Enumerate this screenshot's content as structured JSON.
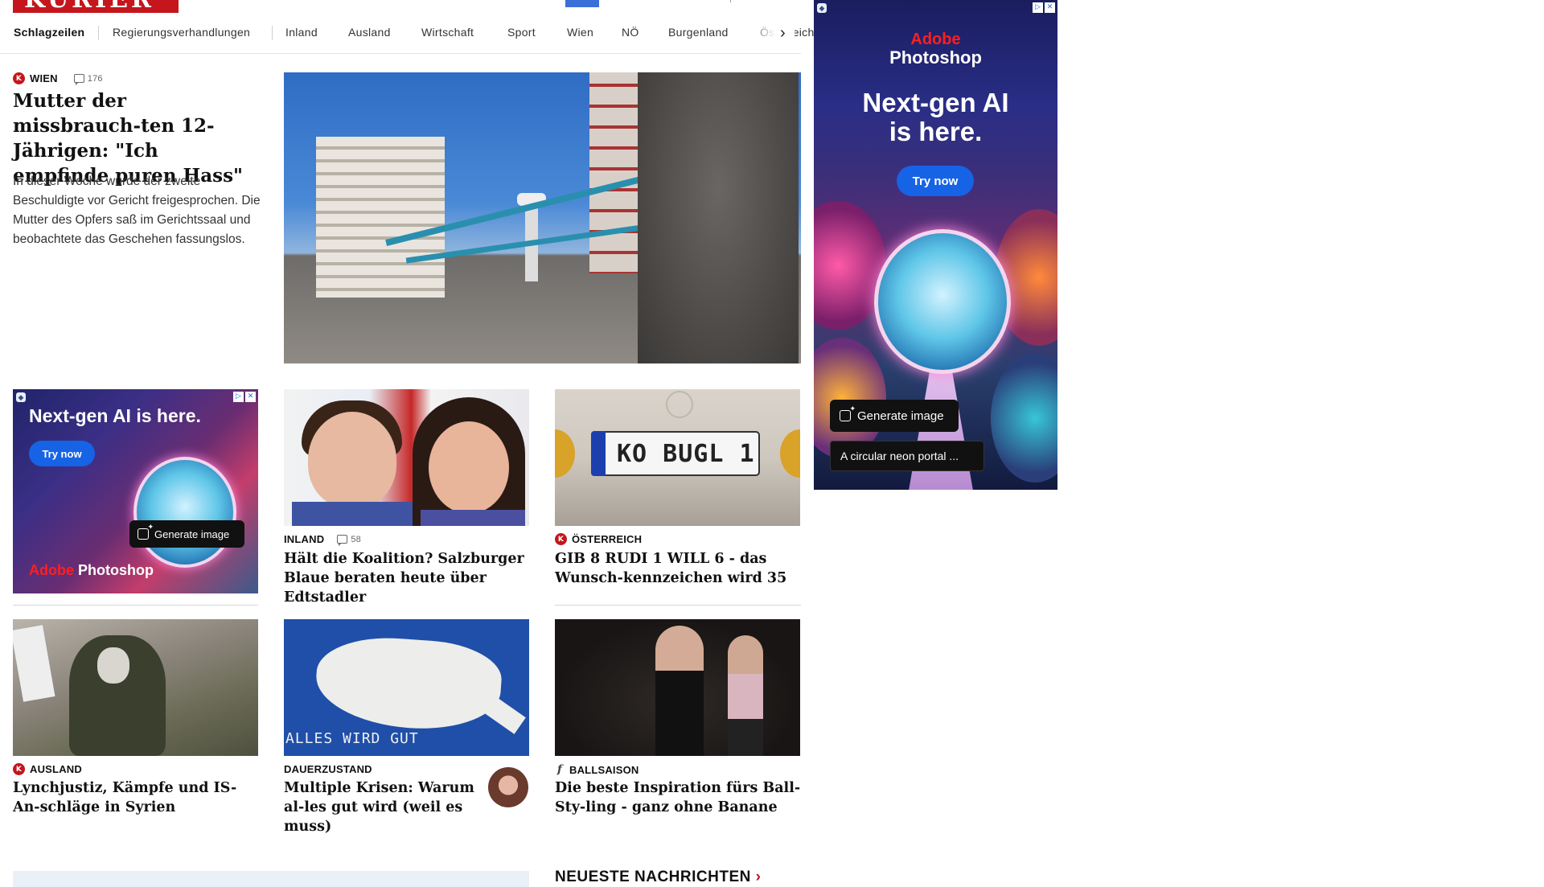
{
  "header": {
    "logo": "KURIER"
  },
  "nav": {
    "items": [
      {
        "label": "Schlagzeilen"
      },
      {
        "label": "Regierungsverhandlungen"
      },
      {
        "label": "Inland"
      },
      {
        "label": "Ausland"
      },
      {
        "label": "Wirtschaft"
      },
      {
        "label": "Sport"
      },
      {
        "label": "Wien"
      },
      {
        "label": "NÖ"
      },
      {
        "label": "Burgenland"
      },
      {
        "label": "Österreich"
      }
    ],
    "next_icon": "chevron-right-icon"
  },
  "lead": {
    "kicker": "WIEN",
    "comments": "176",
    "headline": "Mutter der missbrauch-ten 12-Jährigen: \"Ich empfinde puren Hass\"",
    "teaser": "In dieser Woche wurde der zweite Beschuldigte vor Gericht freigesprochen. Die Mutter des Opfers saß im Gerichtssaal und beobachtete das Geschehen fassungslos."
  },
  "cards": [
    {
      "kicker": "INLAND",
      "comments": "58",
      "headline": "Hält die Koalition? Salzburger Blaue beraten heute über Edtstadler"
    },
    {
      "kicker": "ÖSTERREICH",
      "headline": "GIB 8 RUDI 1 WILL 6 - das Wunsch-kennzeichen wird 35",
      "plate": "KO BUGL 1"
    },
    {
      "kicker": "AUSLAND",
      "headline": "Lynchjustiz, Kämpfe und IS-An-schläge in Syrien"
    },
    {
      "kicker": "DAUERZUSTAND",
      "headline": "Multiple Krisen: Warum al-les gut wird (weil es muss)",
      "image_text": "ALLES WIRD GUT"
    },
    {
      "kicker": "BALLSAISON",
      "headline": "Die beste Inspiration fürs Ball-Sty-ling - ganz ohne Banane"
    }
  ],
  "ad_side": {
    "brand_a": "Adobe",
    "brand_b": "Photoshop",
    "headline": "Next-gen AI is here.",
    "cta": "Try now",
    "generate": "Generate image",
    "prompt": "A circular neon portal ..."
  },
  "ad_inline": {
    "headline": "Next-gen AI is here.",
    "cta": "Try now",
    "generate": "Generate image",
    "brand_a": "Adobe",
    "brand_b": "Photoshop"
  },
  "bottom": {
    "section_title": "NEUESTE NACHRICHTEN"
  },
  "colors": {
    "brand_red": "#c4161c",
    "cta_blue": "#1663e6"
  }
}
